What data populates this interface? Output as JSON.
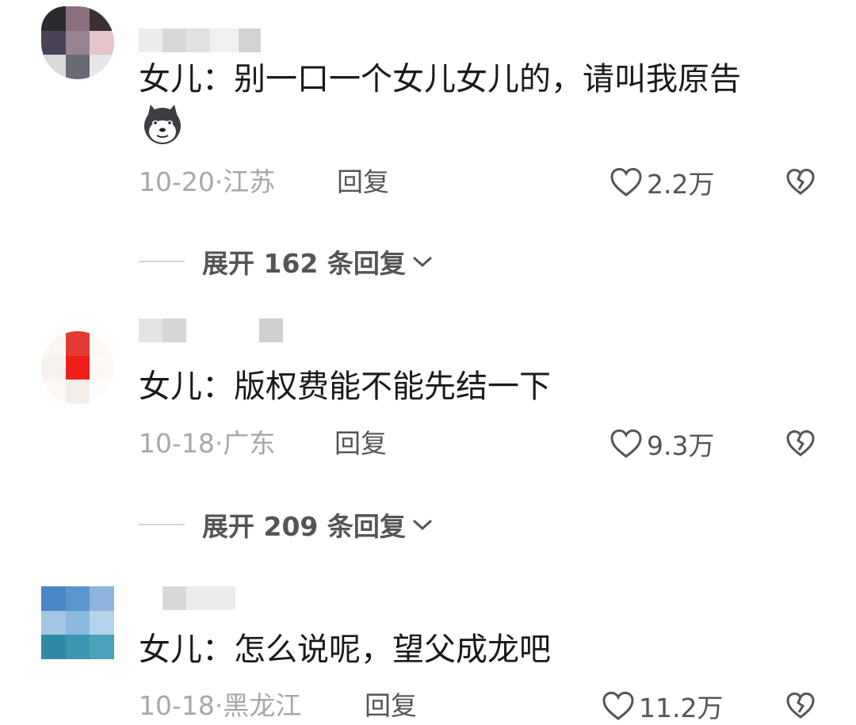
{
  "comments": [
    {
      "text": "女儿：别一口一个女儿女儿的，请叫我原告",
      "emoji": "husky-dog-emoji-icon",
      "date": "10-20",
      "location": "江苏",
      "reply_label": "回复",
      "likes": "2.2万",
      "expand_label": "展开 162 条回复"
    },
    {
      "text": "女儿：版权费能不能先结一下",
      "date": "10-18",
      "location": "广东",
      "reply_label": "回复",
      "likes": "9.3万",
      "expand_label": "展开 209 条回复"
    },
    {
      "text": "女儿：怎么说呢，望父成龙吧",
      "date": "10-18",
      "location": "黑龙江",
      "reply_label": "回复",
      "likes": "11.2万"
    }
  ],
  "icons": {
    "like": "heart-outline-icon",
    "dislike": "broken-heart-icon",
    "expand": "chevron-down-icon"
  },
  "colors": {
    "text": "#1a1a1a",
    "meta": "#a8a8a8",
    "action": "#555555"
  }
}
